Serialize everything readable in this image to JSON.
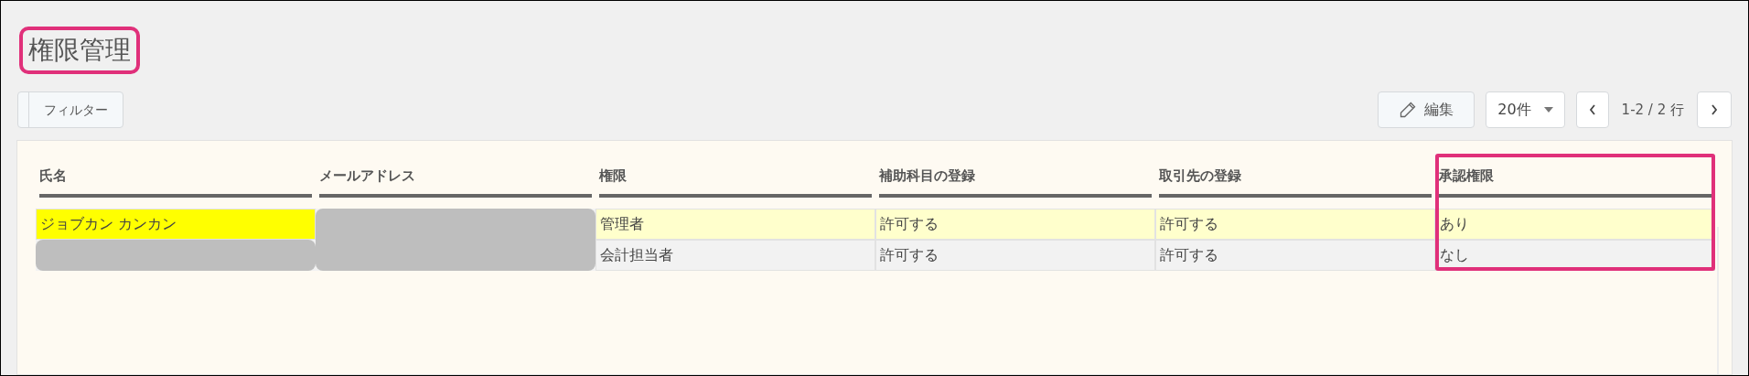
{
  "page_title": {
    "text": "権限管理",
    "outlined": true
  },
  "toolbar": {
    "filter_button": "フィルター",
    "edit_button": "編集",
    "page_size": "20件",
    "range": "1-2 / 2 行"
  },
  "table": {
    "columns": [
      {
        "label": "氏名",
        "outlined": false
      },
      {
        "label": "メールアドレス",
        "outlined": false
      },
      {
        "label": "権限",
        "outlined": false
      },
      {
        "label": "補助科目の登録",
        "outlined": false
      },
      {
        "label": "取引先の登録",
        "outlined": false
      },
      {
        "label": "承認権限",
        "outlined": true
      }
    ],
    "rows": [
      {
        "selected": true,
        "cells": [
          {
            "kind": "text",
            "text": "ジョブカン カンカン",
            "highlighted": true
          },
          {
            "kind": "redacted"
          },
          {
            "kind": "text",
            "text": "管理者",
            "highlighted": false
          },
          {
            "kind": "text",
            "text": "許可する",
            "highlighted": false
          },
          {
            "kind": "text",
            "text": "許可する",
            "highlighted": false
          },
          {
            "kind": "text",
            "text": "あり",
            "highlighted": false
          }
        ]
      },
      {
        "selected": false,
        "cells": [
          {
            "kind": "redacted"
          },
          {
            "kind": "redacted"
          },
          {
            "kind": "text",
            "text": "会計担当者",
            "highlighted": false
          },
          {
            "kind": "text",
            "text": "許可する",
            "highlighted": false
          },
          {
            "kind": "text",
            "text": "許可する",
            "highlighted": false
          },
          {
            "kind": "text",
            "text": "なし",
            "highlighted": false
          }
        ]
      }
    ]
  }
}
